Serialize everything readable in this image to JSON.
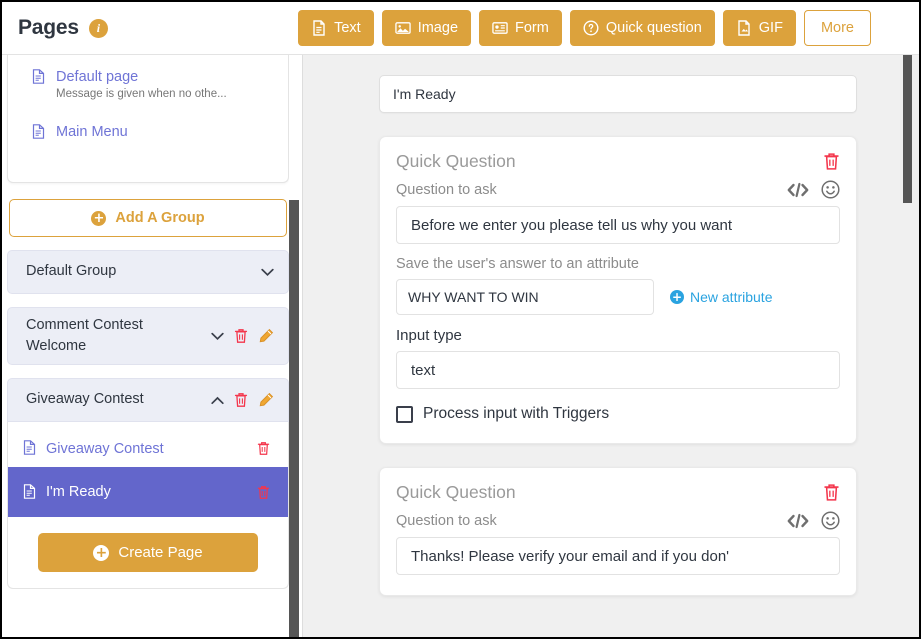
{
  "header": {
    "title": "Pages",
    "info_icon": "info-icon",
    "actions": [
      {
        "label": "Text",
        "icon": "document-icon",
        "style": "filled"
      },
      {
        "label": "Image",
        "icon": "image-icon",
        "style": "filled"
      },
      {
        "label": "Form",
        "icon": "form-icon",
        "style": "filled"
      },
      {
        "label": "Quick question",
        "icon": "question-circle-icon",
        "style": "filled"
      },
      {
        "label": "GIF",
        "icon": "gif-icon",
        "style": "filled"
      },
      {
        "label": "More",
        "icon": "",
        "style": "ghost"
      }
    ]
  },
  "sidebar": {
    "top_pages": [
      {
        "label": "Default page",
        "sub": "Message is given when no othe...",
        "icon": "document-icon"
      },
      {
        "label": "Main Menu",
        "sub": "",
        "icon": "document-icon"
      }
    ],
    "add_group_label": "Add A Group",
    "groups": [
      {
        "name": "Default Group",
        "expanded": false,
        "chevron": "chevron-down-icon",
        "has_actions": false,
        "pages": []
      },
      {
        "name": "Comment Contest Welcome",
        "expanded": false,
        "chevron": "chevron-down-icon",
        "has_actions": true,
        "pages": []
      },
      {
        "name": "Giveaway Contest",
        "expanded": true,
        "chevron": "chevron-up-icon",
        "has_actions": true,
        "pages": [
          {
            "label": "Giveaway Contest",
            "selected": false
          },
          {
            "label": "I'm Ready",
            "selected": true
          }
        ]
      }
    ],
    "create_page_label": "Create Page"
  },
  "main": {
    "page_title_value": "I'm Ready",
    "cards": [
      {
        "type": "Quick Question",
        "question_label": "Question to ask",
        "question_value": "Before we enter you please tell us why you want",
        "attribute_label": "Save the user's answer to an attribute",
        "attribute_value": "WHY WANT TO WIN",
        "new_attribute_label": "New attribute",
        "input_type_label": "Input type",
        "input_type_value": "text",
        "checkbox_label": "Process input with Triggers",
        "checkbox_checked": false
      },
      {
        "type": "Quick Question",
        "question_label": "Question to ask",
        "question_value": "Thanks! Please verify your email and if you don'",
        "attribute_label": "",
        "attribute_value": "",
        "new_attribute_label": "",
        "input_type_label": "",
        "input_type_value": "",
        "checkbox_label": "",
        "checkbox_checked": false
      }
    ]
  },
  "colors": {
    "accent_orange": "#dca23c",
    "selected_purple": "#6366cb",
    "link_purple": "#6f74d6",
    "danger_red": "#f4364c",
    "link_blue": "#2aa3e0",
    "main_bg": "#f0f0f0"
  }
}
